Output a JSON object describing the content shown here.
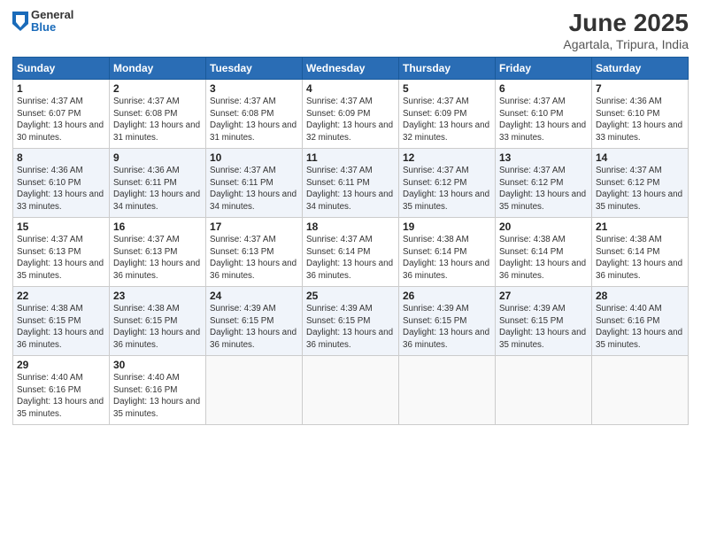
{
  "header": {
    "logo_general": "General",
    "logo_blue": "Blue",
    "title": "June 2025",
    "subtitle": "Agartala, Tripura, India"
  },
  "days_of_week": [
    "Sunday",
    "Monday",
    "Tuesday",
    "Wednesday",
    "Thursday",
    "Friday",
    "Saturday"
  ],
  "weeks": [
    [
      {
        "day": "1",
        "sunrise": "Sunrise: 4:37 AM",
        "sunset": "Sunset: 6:07 PM",
        "daylight": "Daylight: 13 hours and 30 minutes."
      },
      {
        "day": "2",
        "sunrise": "Sunrise: 4:37 AM",
        "sunset": "Sunset: 6:08 PM",
        "daylight": "Daylight: 13 hours and 31 minutes."
      },
      {
        "day": "3",
        "sunrise": "Sunrise: 4:37 AM",
        "sunset": "Sunset: 6:08 PM",
        "daylight": "Daylight: 13 hours and 31 minutes."
      },
      {
        "day": "4",
        "sunrise": "Sunrise: 4:37 AM",
        "sunset": "Sunset: 6:09 PM",
        "daylight": "Daylight: 13 hours and 32 minutes."
      },
      {
        "day": "5",
        "sunrise": "Sunrise: 4:37 AM",
        "sunset": "Sunset: 6:09 PM",
        "daylight": "Daylight: 13 hours and 32 minutes."
      },
      {
        "day": "6",
        "sunrise": "Sunrise: 4:37 AM",
        "sunset": "Sunset: 6:10 PM",
        "daylight": "Daylight: 13 hours and 33 minutes."
      },
      {
        "day": "7",
        "sunrise": "Sunrise: 4:36 AM",
        "sunset": "Sunset: 6:10 PM",
        "daylight": "Daylight: 13 hours and 33 minutes."
      }
    ],
    [
      {
        "day": "8",
        "sunrise": "Sunrise: 4:36 AM",
        "sunset": "Sunset: 6:10 PM",
        "daylight": "Daylight: 13 hours and 33 minutes."
      },
      {
        "day": "9",
        "sunrise": "Sunrise: 4:36 AM",
        "sunset": "Sunset: 6:11 PM",
        "daylight": "Daylight: 13 hours and 34 minutes."
      },
      {
        "day": "10",
        "sunrise": "Sunrise: 4:37 AM",
        "sunset": "Sunset: 6:11 PM",
        "daylight": "Daylight: 13 hours and 34 minutes."
      },
      {
        "day": "11",
        "sunrise": "Sunrise: 4:37 AM",
        "sunset": "Sunset: 6:11 PM",
        "daylight": "Daylight: 13 hours and 34 minutes."
      },
      {
        "day": "12",
        "sunrise": "Sunrise: 4:37 AM",
        "sunset": "Sunset: 6:12 PM",
        "daylight": "Daylight: 13 hours and 35 minutes."
      },
      {
        "day": "13",
        "sunrise": "Sunrise: 4:37 AM",
        "sunset": "Sunset: 6:12 PM",
        "daylight": "Daylight: 13 hours and 35 minutes."
      },
      {
        "day": "14",
        "sunrise": "Sunrise: 4:37 AM",
        "sunset": "Sunset: 6:12 PM",
        "daylight": "Daylight: 13 hours and 35 minutes."
      }
    ],
    [
      {
        "day": "15",
        "sunrise": "Sunrise: 4:37 AM",
        "sunset": "Sunset: 6:13 PM",
        "daylight": "Daylight: 13 hours and 35 minutes."
      },
      {
        "day": "16",
        "sunrise": "Sunrise: 4:37 AM",
        "sunset": "Sunset: 6:13 PM",
        "daylight": "Daylight: 13 hours and 36 minutes."
      },
      {
        "day": "17",
        "sunrise": "Sunrise: 4:37 AM",
        "sunset": "Sunset: 6:13 PM",
        "daylight": "Daylight: 13 hours and 36 minutes."
      },
      {
        "day": "18",
        "sunrise": "Sunrise: 4:37 AM",
        "sunset": "Sunset: 6:14 PM",
        "daylight": "Daylight: 13 hours and 36 minutes."
      },
      {
        "day": "19",
        "sunrise": "Sunrise: 4:38 AM",
        "sunset": "Sunset: 6:14 PM",
        "daylight": "Daylight: 13 hours and 36 minutes."
      },
      {
        "day": "20",
        "sunrise": "Sunrise: 4:38 AM",
        "sunset": "Sunset: 6:14 PM",
        "daylight": "Daylight: 13 hours and 36 minutes."
      },
      {
        "day": "21",
        "sunrise": "Sunrise: 4:38 AM",
        "sunset": "Sunset: 6:14 PM",
        "daylight": "Daylight: 13 hours and 36 minutes."
      }
    ],
    [
      {
        "day": "22",
        "sunrise": "Sunrise: 4:38 AM",
        "sunset": "Sunset: 6:15 PM",
        "daylight": "Daylight: 13 hours and 36 minutes."
      },
      {
        "day": "23",
        "sunrise": "Sunrise: 4:38 AM",
        "sunset": "Sunset: 6:15 PM",
        "daylight": "Daylight: 13 hours and 36 minutes."
      },
      {
        "day": "24",
        "sunrise": "Sunrise: 4:39 AM",
        "sunset": "Sunset: 6:15 PM",
        "daylight": "Daylight: 13 hours and 36 minutes."
      },
      {
        "day": "25",
        "sunrise": "Sunrise: 4:39 AM",
        "sunset": "Sunset: 6:15 PM",
        "daylight": "Daylight: 13 hours and 36 minutes."
      },
      {
        "day": "26",
        "sunrise": "Sunrise: 4:39 AM",
        "sunset": "Sunset: 6:15 PM",
        "daylight": "Daylight: 13 hours and 36 minutes."
      },
      {
        "day": "27",
        "sunrise": "Sunrise: 4:39 AM",
        "sunset": "Sunset: 6:15 PM",
        "daylight": "Daylight: 13 hours and 35 minutes."
      },
      {
        "day": "28",
        "sunrise": "Sunrise: 4:40 AM",
        "sunset": "Sunset: 6:16 PM",
        "daylight": "Daylight: 13 hours and 35 minutes."
      }
    ],
    [
      {
        "day": "29",
        "sunrise": "Sunrise: 4:40 AM",
        "sunset": "Sunset: 6:16 PM",
        "daylight": "Daylight: 13 hours and 35 minutes."
      },
      {
        "day": "30",
        "sunrise": "Sunrise: 4:40 AM",
        "sunset": "Sunset: 6:16 PM",
        "daylight": "Daylight: 13 hours and 35 minutes."
      },
      null,
      null,
      null,
      null,
      null
    ]
  ]
}
